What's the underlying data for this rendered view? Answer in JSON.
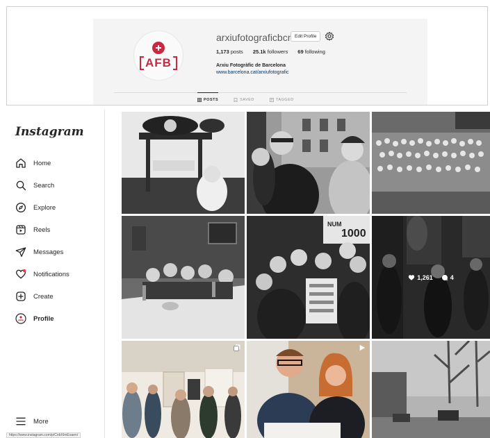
{
  "profile": {
    "username": "arxiufotograficbcn",
    "edit_label": "Edit Profile",
    "posts_count": "1,173",
    "posts_label": "posts",
    "followers_count": "25.1k",
    "followers_label": "followers",
    "following_count": "69",
    "following_label": "following",
    "full_name": "Arxiu Fotogràfic de Barcelona",
    "website": "www.barcelona.cat/arxiufotografic",
    "avatar_text": "AFB",
    "brand_color": "#c9283e"
  },
  "tabs": [
    {
      "label": "POSTS",
      "icon": "grid-icon",
      "active": true
    },
    {
      "label": "SAVED",
      "icon": "bookmark-icon",
      "active": false
    },
    {
      "label": "TAGGED",
      "icon": "tag-icon",
      "active": false
    }
  ],
  "sidebar": {
    "brand": "Instagram",
    "items": [
      {
        "label": "Home",
        "icon": "home-icon"
      },
      {
        "label": "Search",
        "icon": "search-icon"
      },
      {
        "label": "Explore",
        "icon": "compass-icon"
      },
      {
        "label": "Reels",
        "icon": "reels-icon"
      },
      {
        "label": "Messages",
        "icon": "send-icon"
      },
      {
        "label": "Notifications",
        "icon": "heart-icon"
      },
      {
        "label": "Create",
        "icon": "plus-square-icon"
      },
      {
        "label": "Profile",
        "icon": "avatar-icon"
      }
    ],
    "more_label": "More"
  },
  "hover_post": {
    "likes": "1,261",
    "comments": "4"
  },
  "status_url": "https://www.instagram.com/p/CnbXImEoaen/"
}
